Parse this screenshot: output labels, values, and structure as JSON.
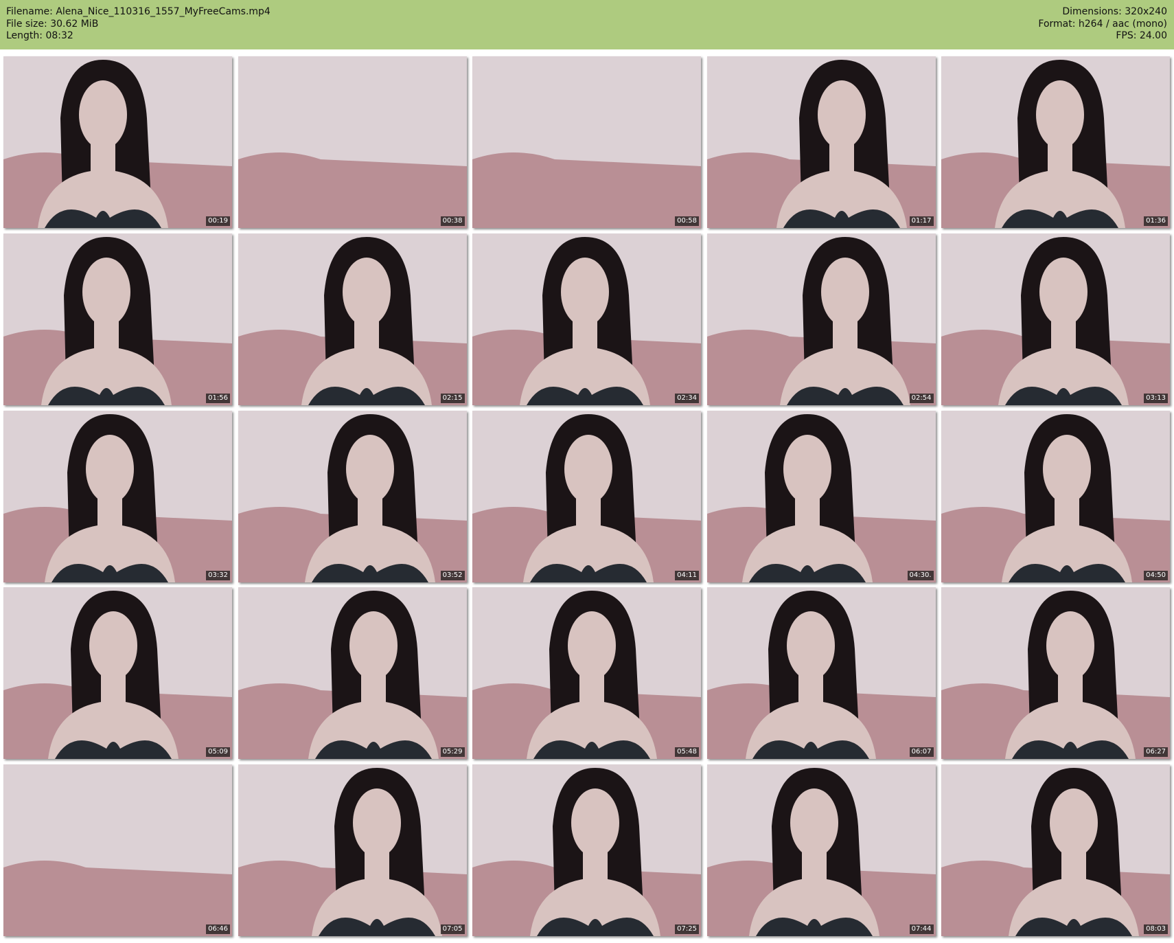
{
  "header": {
    "filename_label": "Filename:",
    "filename": "Alena_Nice_110316_1557_MyFreeCams.mp4",
    "filesize_label": "File size:",
    "filesize": "30.62 MiB",
    "length_label": "Length:",
    "length": "08:32",
    "dimensions_label": "Dimensions:",
    "dimensions": "320x240",
    "format_label": "Format:",
    "format": "h264 / aac (mono)",
    "fps_label": "FPS:",
    "fps": "24.00"
  },
  "colors": {
    "header_bg": "#aecb7f",
    "wall": "#dcd1d5",
    "couch": "#b98f95",
    "hair": "#1b1416",
    "skin": "#d8c3c0",
    "bra": "#262b32",
    "timestamp_bg": "#1f1f1f"
  },
  "thumbnails": [
    {
      "time": "00:19",
      "scene": "person"
    },
    {
      "time": "00:38",
      "scene": "empty"
    },
    {
      "time": "00:58",
      "scene": "empty"
    },
    {
      "time": "01:17",
      "scene": "person"
    },
    {
      "time": "01:36",
      "scene": "person"
    },
    {
      "time": "01:56",
      "scene": "person"
    },
    {
      "time": "02:15",
      "scene": "person"
    },
    {
      "time": "02:34",
      "scene": "person"
    },
    {
      "time": "02:54",
      "scene": "person"
    },
    {
      "time": "03:13",
      "scene": "person"
    },
    {
      "time": "03:32",
      "scene": "person"
    },
    {
      "time": "03:52",
      "scene": "person"
    },
    {
      "time": "04:11",
      "scene": "person"
    },
    {
      "time": "04:30.",
      "scene": "person"
    },
    {
      "time": "04:50",
      "scene": "person"
    },
    {
      "time": "05:09",
      "scene": "person"
    },
    {
      "time": "05:29",
      "scene": "person"
    },
    {
      "time": "05:48",
      "scene": "person"
    },
    {
      "time": "06:07",
      "scene": "person"
    },
    {
      "time": "06:27",
      "scene": "person"
    },
    {
      "time": "06:46",
      "scene": "empty"
    },
    {
      "time": "07:05",
      "scene": "person"
    },
    {
      "time": "07:25",
      "scene": "person"
    },
    {
      "time": "07:44",
      "scene": "person"
    },
    {
      "time": "08:03",
      "scene": "person"
    }
  ]
}
